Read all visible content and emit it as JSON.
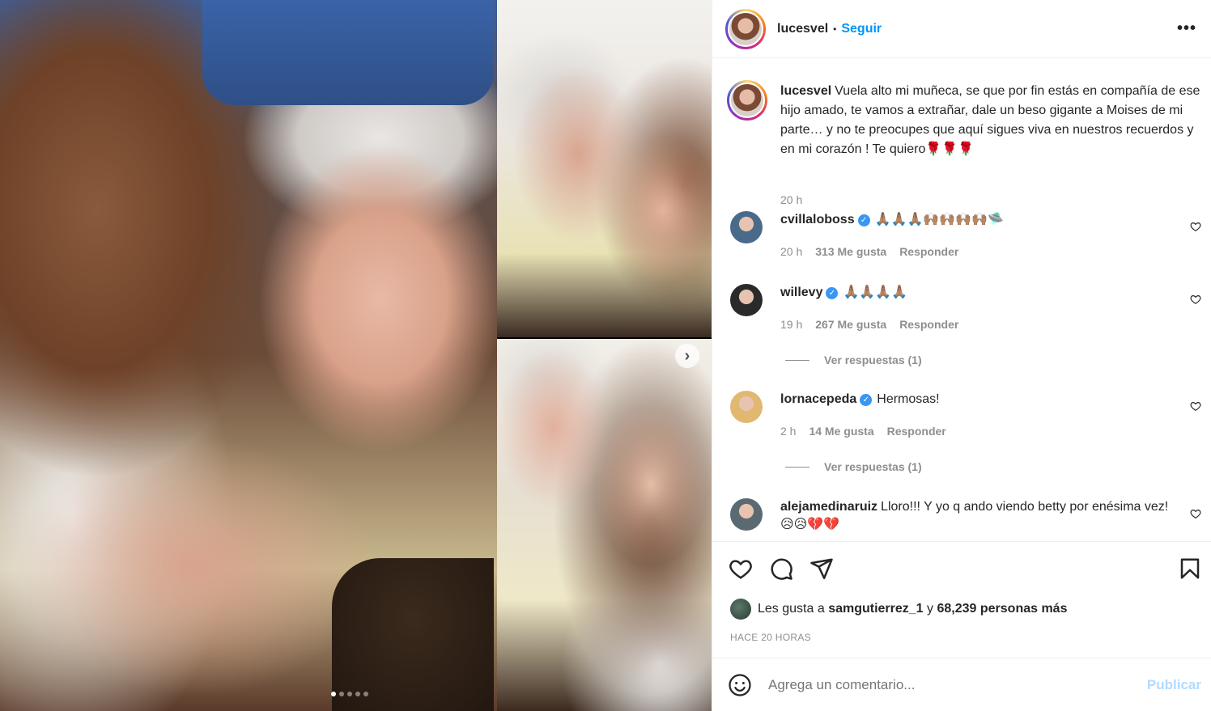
{
  "media": {
    "carousel_total": 5,
    "carousel_active_index": 0
  },
  "post": {
    "username": "lucesvel",
    "separator": "•",
    "follow_label": "Seguir",
    "more_label": "•••",
    "caption": "Vuela alto mi muñeca, se que por fin estás en compañía de ese hijo amado, te vamos a extrañar, dale un beso gigante a Moises de mi parte… y no te preocupes que aquí sigues viva en nuestros recuerdos y en mi corazón ! Te quiero🌹🌹🌹",
    "caption_time": "20 h"
  },
  "comments": [
    {
      "user": "cvillaloboss",
      "verified": true,
      "text": "🙏🏽🙏🏽🙏🏽🙌🏽🙌🏽🙌🏽🙌🏽🛸",
      "time": "20 h",
      "likes": "313 Me gusta",
      "reply": "Responder",
      "avatar_color": "#4a6a8a"
    },
    {
      "user": "willevy",
      "verified": true,
      "text": "🙏🏽🙏🏽🙏🏽🙏🏽",
      "time": "19 h",
      "likes": "267 Me gusta",
      "reply": "Responder",
      "replies": "Ver respuestas (1)",
      "avatar_color": "#2a2a2a"
    },
    {
      "user": "lornacepeda",
      "verified": true,
      "text": "Hermosas!",
      "time": "2 h",
      "likes": "14 Me gusta",
      "reply": "Responder",
      "replies": "Ver respuestas (1)",
      "avatar_color": "#e0b870"
    },
    {
      "user": "alejamedinaruiz",
      "verified": false,
      "text": "Lloro!!! Y yo q ando viendo betty por enésima vez! 😥😥💔💔",
      "avatar_color": "#5a6a70"
    }
  ],
  "likes": {
    "prefix": "Les gusta a",
    "user": "samgutierrez_1",
    "connector": "y",
    "others": "68,239 personas más"
  },
  "post_date": "HACE 20 HORAS",
  "add_comment": {
    "placeholder": "Agrega un comentario...",
    "publish_label": "Publicar"
  },
  "icons": {
    "like": "heart-icon",
    "comment": "comment-icon",
    "share": "send-icon",
    "save": "bookmark-icon",
    "emoji": "emoji-icon",
    "next": "chevron-right-icon"
  },
  "colors": {
    "link": "#0095f6",
    "verified": "#3897f0",
    "muted": "#8e8e8e",
    "publish_disabled": "#b3dbff"
  }
}
